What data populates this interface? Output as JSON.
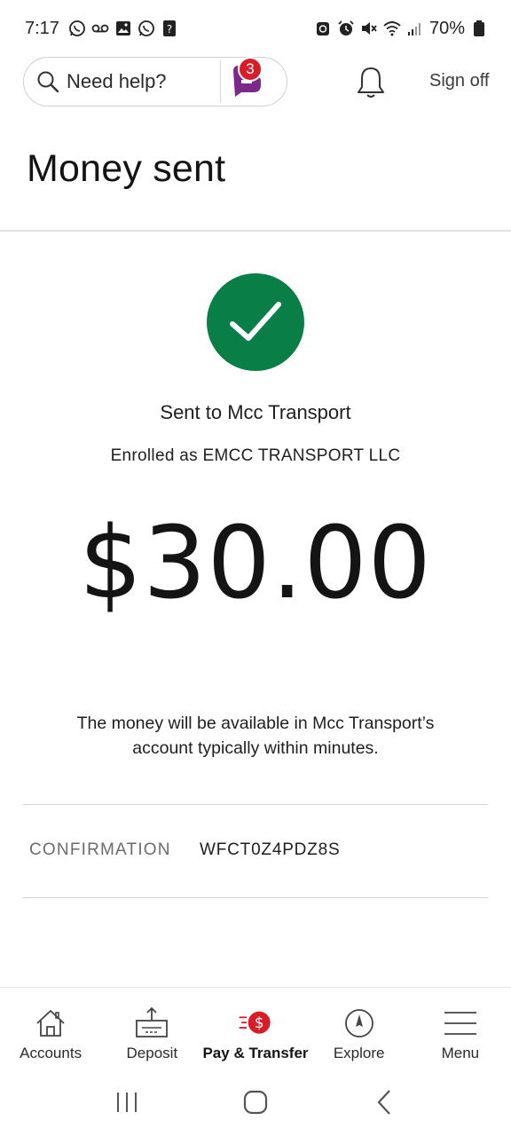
{
  "status_bar": {
    "time": "7:17",
    "battery": "70%",
    "left_icons": [
      "whatsapp-icon",
      "voicemail-icon",
      "gallery-icon",
      "whatsapp-icon",
      "unknown-app-icon"
    ],
    "right_icons": [
      "recycle-icon",
      "alarm-icon",
      "mute-icon",
      "wifi-icon",
      "signal-icon",
      "battery-icon"
    ]
  },
  "header": {
    "search_placeholder": "Need help?",
    "assistant_badge_count": "3",
    "sign_off_label": "Sign off"
  },
  "page": {
    "title": "Money sent",
    "sent_to": "Sent to Mcc Transport",
    "enrolled_as": "Enrolled as EMCC TRANSPORT LLC",
    "amount": "$30.00",
    "availability_line1": "The money will be available in Mcc Transport’s",
    "availability_line2": "account typically within minutes.",
    "confirmation_label": "CONFIRMATION",
    "confirmation_value": "WFCT0Z4PDZ8S"
  },
  "bottom_nav": {
    "items": [
      {
        "label": "Accounts",
        "icon": "home-icon"
      },
      {
        "label": "Deposit",
        "icon": "deposit-icon"
      },
      {
        "label": "Pay & Transfer",
        "icon": "pay-transfer-icon"
      },
      {
        "label": "Explore",
        "icon": "compass-icon"
      },
      {
        "label": "Menu",
        "icon": "menu-icon"
      }
    ],
    "active": "Pay & Transfer"
  },
  "colors": {
    "success_green": "#0a7e47",
    "brand_red": "#d71e28",
    "assistant_purple": "#7b2a8c"
  }
}
